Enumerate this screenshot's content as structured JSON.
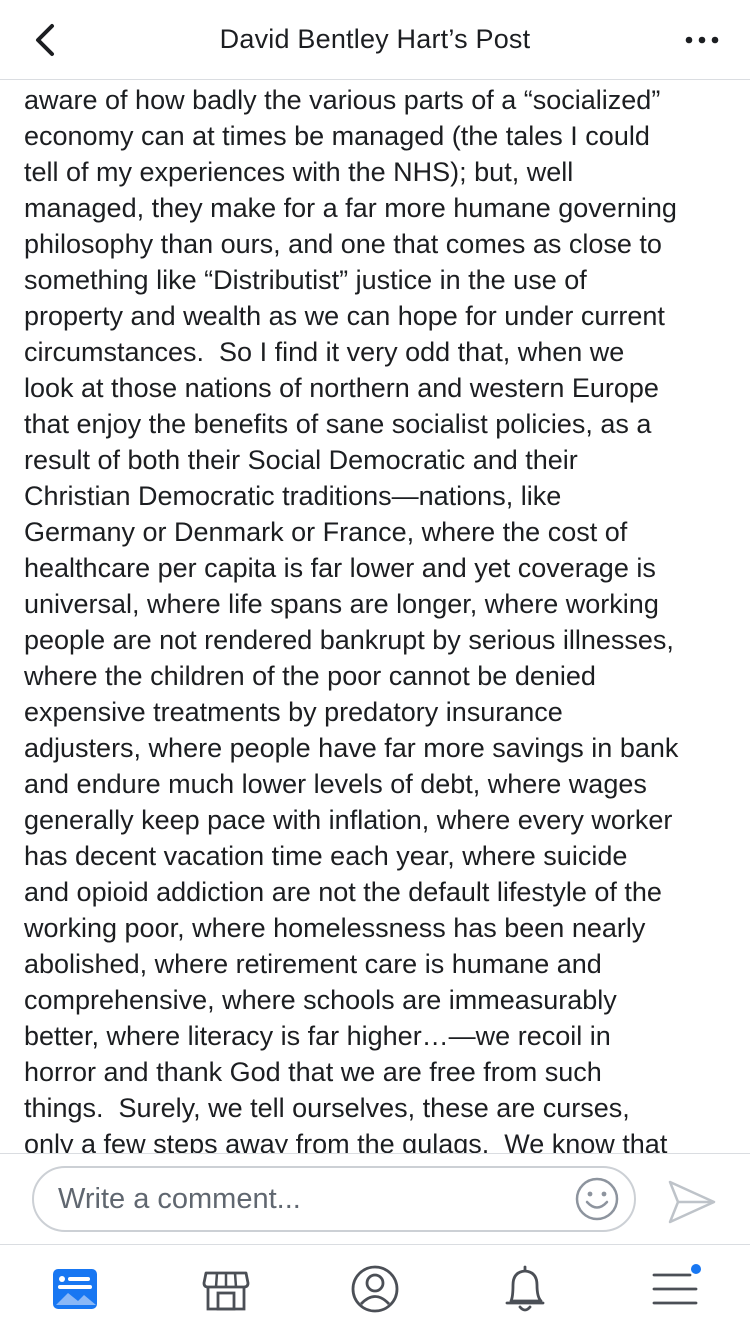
{
  "header": {
    "title": "David Bentley Hart’s Post",
    "back_icon": "chevron-left-icon",
    "more_icon": "more-horizontal-icon"
  },
  "post": {
    "lines": [
      "aware of how badly the various parts of a “socialized”",
      "economy can at times be managed (the tales I could",
      "tell of my experiences with the NHS); but, well",
      "managed, they make for a far more humane governing",
      "philosophy than ours, and one that comes as close to",
      "something like “Distributist” justice in the use of",
      "property and wealth as we can hope for under current",
      "circumstances.  So I find it very odd that, when we",
      "look at those nations of northern and western Europe",
      "that enjoy the benefits of sane socialist policies, as a",
      "result of both their Social Democratic and their",
      "Christian Democratic traditions—nations, like",
      "Germany or Denmark or France, where the cost of",
      "healthcare per capita is far lower and yet coverage is",
      "universal, where life spans are longer, where working",
      "people are not rendered bankrupt by serious illnesses,",
      "where the children of the poor cannot be denied",
      "expensive treatments by predatory insurance",
      "adjusters, where people have far more savings in bank",
      "and endure much lower levels of debt, where wages",
      "generally keep pace with inflation, where every worker",
      "has decent vacation time each year, where suicide",
      "and opioid addiction are not the default lifestyle of the",
      "working poor, where homelessness has been nearly",
      "abolished, where retirement care is humane and",
      "comprehensive, where schools are immeasurably",
      "better, where literacy is far higher…—we recoil in",
      "horror and thank God that we are free from such",
      "things.  Surely, we tell ourselves, these are curses,",
      "only a few steps away from the gulags.  We know that"
    ]
  },
  "composer": {
    "placeholder": "Write a comment...",
    "emoji_icon": "smiley-icon",
    "send_icon": "send-icon"
  },
  "tabs": [
    {
      "name": "news-feed",
      "icon": "news-feed-icon",
      "active": true
    },
    {
      "name": "marketplace",
      "icon": "marketplace-icon",
      "active": false
    },
    {
      "name": "profile",
      "icon": "profile-icon",
      "active": false
    },
    {
      "name": "notifications",
      "icon": "bell-icon",
      "active": false
    },
    {
      "name": "menu",
      "icon": "hamburger-menu-icon",
      "active": false,
      "badge": true
    }
  ],
  "colors": {
    "accent": "#1877f2",
    "icon_gray": "#4b4f56",
    "text": "#1c1e21",
    "placeholder": "#606770",
    "border": "#ccd0d5"
  }
}
